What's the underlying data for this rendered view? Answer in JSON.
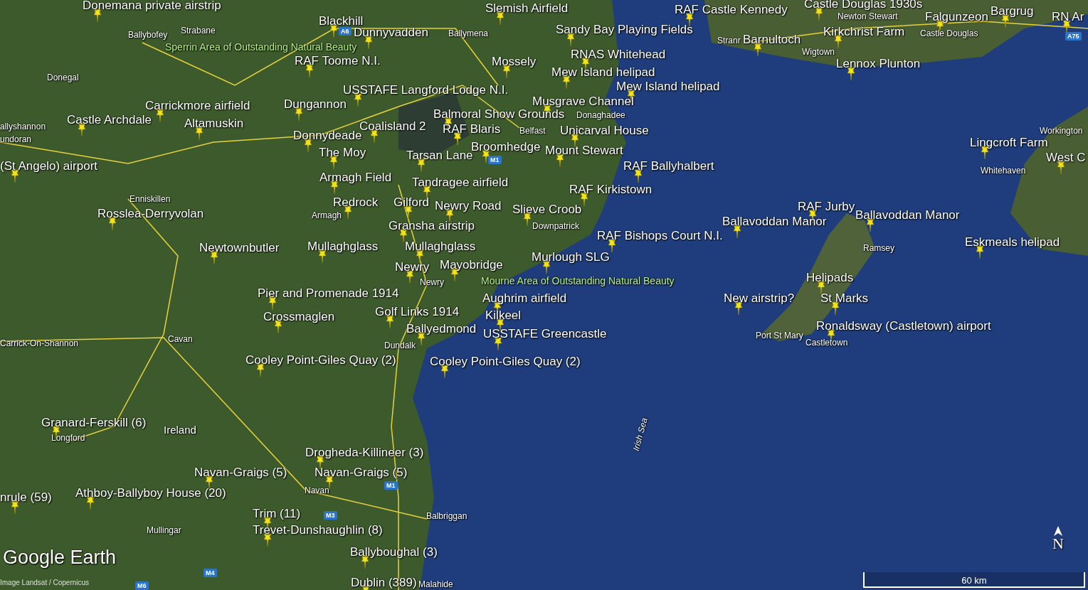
{
  "placemarks": [
    "Donemana private airstrip",
    "Slemish Airfield",
    "RAF Castle Kennedy",
    "Castle Douglas 1930s",
    "Falgunzeon",
    "Bargrug",
    "RN Ar",
    "Blackhill",
    "Dunnyvadden",
    "Sandy Bay Playing Fields",
    "Barnultoch",
    "Kirkchrist Farm",
    "RAF Toome N.I.",
    "Mossely",
    "RNAS Whitehead",
    "Lennox Plunton",
    "Mew Island helipad",
    "USSTAFE Langford Lodge N.I.",
    "Mew Island helipad",
    "Carrickmore airfield",
    "Dungannon",
    "Musgrave Channel",
    "Castle Archdale",
    "Altamuskin",
    "Balmoral Show Grounds",
    "Coalisland 2",
    "RAF Blaris",
    "Unicarval House",
    "Donnydeade",
    "The Moy",
    "Tarsan Lane",
    "Broomhedge",
    "Mount Stewart",
    "Lingcroft Farm",
    "West C",
    "(St Angelo) airport",
    "RAF Ballyhalbert",
    "Armagh Field",
    "Tandragee airfield",
    "RAF Kirkistown",
    "Redrock",
    "Gilford",
    "Newry Road",
    "Slieve Croob",
    "RAF Jurby",
    "Rosslea-Derryvolan",
    "Ballavoddan Manor",
    "Ballavoddan Manor",
    "Gransha airstrip",
    "RAF Bishops Court N.I.",
    "Eskmeals helipad",
    "Newtownbutler",
    "Mullaghglass",
    "Mullaghglass",
    "Murlough SLG",
    "Newry",
    "Mayobridge",
    "Helipads",
    "Pier and Promenade 1914",
    "Aughrim airfield",
    "New airstrip?",
    "St Marks",
    "Crossmaglen",
    "Golf Links 1914",
    "Kilkeel",
    "Ballyedmond",
    "USSTAFE Greencastle",
    "Ronaldsway (Castletown) airport",
    "Cooley Point-Giles Quay (2)",
    "Cooley Point-Giles Quay (2)",
    "Granard-Ferskill (6)",
    "Drogheda-Killineer (3)",
    "Navan-Graigs (5)",
    "Navan-Graigs (5)",
    "nrule (59)",
    "Athboy-Ballyboy House (20)",
    "Trim (11)",
    "Trevet-Dunshaughlin (8)",
    "Ballyboughal (3)",
    "Dublin (389)"
  ],
  "places": [
    "Ballybofey",
    "Strabane",
    "Ballymena",
    "Newton Stewart",
    "Castle Douglas",
    "Stranr",
    "Wigtown",
    "Donegal",
    "Belfast",
    "Donaghadee",
    "allyshannon",
    "undoran",
    "Workington",
    "Whitehaven",
    "Enniskillen",
    "Armagh",
    "Downpatrick",
    "Ramsey",
    "Newry",
    "Carrick-On-Shannon",
    "Cavan",
    "Dundalk",
    "Port St Mary",
    "Castletown",
    "Longford",
    "Navan",
    "Balbriggan",
    "Mullingar",
    "Malahide"
  ],
  "country_label": "Ireland",
  "areas": [
    "Sperrin Area of Outstanding Natural Beauty",
    "Mourne Area of Outstanding Natural Beauty"
  ],
  "sea_label": "Irish Sea",
  "road_shields": [
    "A6",
    "M1",
    "M1",
    "M3",
    "M4",
    "M6",
    "A75"
  ],
  "logo": "Google Earth",
  "imagery_credit": "Image Landsat / Copernicus",
  "scale": "60 km",
  "compass": "N"
}
